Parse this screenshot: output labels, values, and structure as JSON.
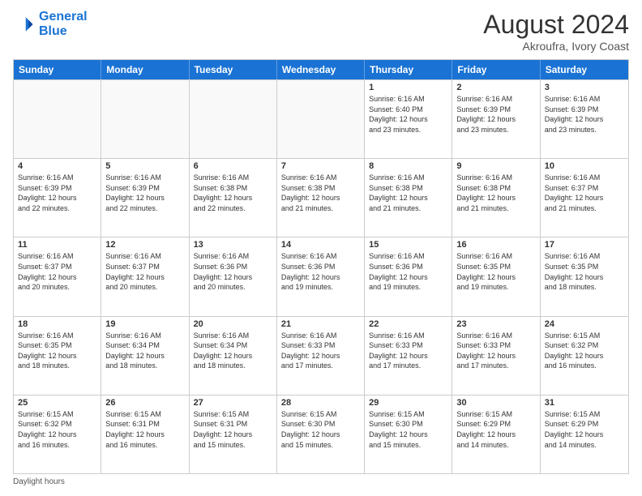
{
  "logo": {
    "line1": "General",
    "line2": "Blue"
  },
  "title": "August 2024",
  "subtitle": "Akroufra, Ivory Coast",
  "days_of_week": [
    "Sunday",
    "Monday",
    "Tuesday",
    "Wednesday",
    "Thursday",
    "Friday",
    "Saturday"
  ],
  "footer_note": "Daylight hours",
  "weeks": [
    [
      {
        "day": "",
        "empty": true
      },
      {
        "day": "",
        "empty": true
      },
      {
        "day": "",
        "empty": true
      },
      {
        "day": "",
        "empty": true
      },
      {
        "day": "1",
        "sunrise": "6:16 AM",
        "sunset": "6:40 PM",
        "daylight": "12 hours and 23 minutes."
      },
      {
        "day": "2",
        "sunrise": "6:16 AM",
        "sunset": "6:39 PM",
        "daylight": "12 hours and 23 minutes."
      },
      {
        "day": "3",
        "sunrise": "6:16 AM",
        "sunset": "6:39 PM",
        "daylight": "12 hours and 23 minutes."
      }
    ],
    [
      {
        "day": "4",
        "sunrise": "6:16 AM",
        "sunset": "6:39 PM",
        "daylight": "12 hours and 22 minutes."
      },
      {
        "day": "5",
        "sunrise": "6:16 AM",
        "sunset": "6:39 PM",
        "daylight": "12 hours and 22 minutes."
      },
      {
        "day": "6",
        "sunrise": "6:16 AM",
        "sunset": "6:38 PM",
        "daylight": "12 hours and 22 minutes."
      },
      {
        "day": "7",
        "sunrise": "6:16 AM",
        "sunset": "6:38 PM",
        "daylight": "12 hours and 21 minutes."
      },
      {
        "day": "8",
        "sunrise": "6:16 AM",
        "sunset": "6:38 PM",
        "daylight": "12 hours and 21 minutes."
      },
      {
        "day": "9",
        "sunrise": "6:16 AM",
        "sunset": "6:38 PM",
        "daylight": "12 hours and 21 minutes."
      },
      {
        "day": "10",
        "sunrise": "6:16 AM",
        "sunset": "6:37 PM",
        "daylight": "12 hours and 21 minutes."
      }
    ],
    [
      {
        "day": "11",
        "sunrise": "6:16 AM",
        "sunset": "6:37 PM",
        "daylight": "12 hours and 20 minutes."
      },
      {
        "day": "12",
        "sunrise": "6:16 AM",
        "sunset": "6:37 PM",
        "daylight": "12 hours and 20 minutes."
      },
      {
        "day": "13",
        "sunrise": "6:16 AM",
        "sunset": "6:36 PM",
        "daylight": "12 hours and 20 minutes."
      },
      {
        "day": "14",
        "sunrise": "6:16 AM",
        "sunset": "6:36 PM",
        "daylight": "12 hours and 19 minutes."
      },
      {
        "day": "15",
        "sunrise": "6:16 AM",
        "sunset": "6:36 PM",
        "daylight": "12 hours and 19 minutes."
      },
      {
        "day": "16",
        "sunrise": "6:16 AM",
        "sunset": "6:35 PM",
        "daylight": "12 hours and 19 minutes."
      },
      {
        "day": "17",
        "sunrise": "6:16 AM",
        "sunset": "6:35 PM",
        "daylight": "12 hours and 18 minutes."
      }
    ],
    [
      {
        "day": "18",
        "sunrise": "6:16 AM",
        "sunset": "6:35 PM",
        "daylight": "12 hours and 18 minutes."
      },
      {
        "day": "19",
        "sunrise": "6:16 AM",
        "sunset": "6:34 PM",
        "daylight": "12 hours and 18 minutes."
      },
      {
        "day": "20",
        "sunrise": "6:16 AM",
        "sunset": "6:34 PM",
        "daylight": "12 hours and 18 minutes."
      },
      {
        "day": "21",
        "sunrise": "6:16 AM",
        "sunset": "6:33 PM",
        "daylight": "12 hours and 17 minutes."
      },
      {
        "day": "22",
        "sunrise": "6:16 AM",
        "sunset": "6:33 PM",
        "daylight": "12 hours and 17 minutes."
      },
      {
        "day": "23",
        "sunrise": "6:16 AM",
        "sunset": "6:33 PM",
        "daylight": "12 hours and 17 minutes."
      },
      {
        "day": "24",
        "sunrise": "6:15 AM",
        "sunset": "6:32 PM",
        "daylight": "12 hours and 16 minutes."
      }
    ],
    [
      {
        "day": "25",
        "sunrise": "6:15 AM",
        "sunset": "6:32 PM",
        "daylight": "12 hours and 16 minutes."
      },
      {
        "day": "26",
        "sunrise": "6:15 AM",
        "sunset": "6:31 PM",
        "daylight": "12 hours and 16 minutes."
      },
      {
        "day": "27",
        "sunrise": "6:15 AM",
        "sunset": "6:31 PM",
        "daylight": "12 hours and 15 minutes."
      },
      {
        "day": "28",
        "sunrise": "6:15 AM",
        "sunset": "6:30 PM",
        "daylight": "12 hours and 15 minutes."
      },
      {
        "day": "29",
        "sunrise": "6:15 AM",
        "sunset": "6:30 PM",
        "daylight": "12 hours and 15 minutes."
      },
      {
        "day": "30",
        "sunrise": "6:15 AM",
        "sunset": "6:29 PM",
        "daylight": "12 hours and 14 minutes."
      },
      {
        "day": "31",
        "sunrise": "6:15 AM",
        "sunset": "6:29 PM",
        "daylight": "12 hours and 14 minutes."
      }
    ]
  ]
}
